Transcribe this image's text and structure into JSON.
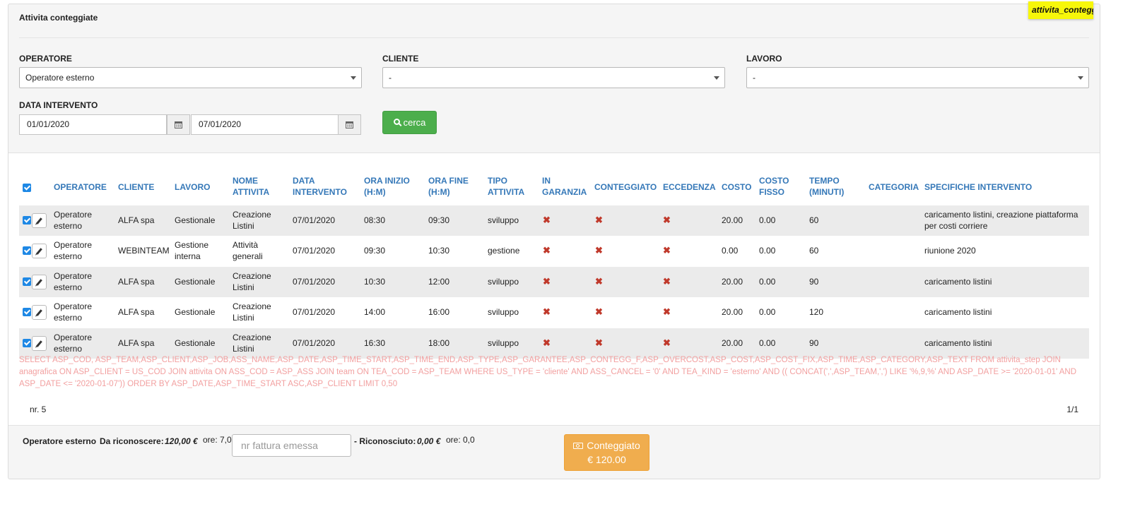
{
  "panel": {
    "title": "Attivita conteggiate",
    "tag": "attivita_conteggi"
  },
  "filters": {
    "operatore": {
      "label": "OPERATORE",
      "value": "Operatore esterno"
    },
    "cliente": {
      "label": "CLIENTE",
      "value": "-"
    },
    "lavoro": {
      "label": "LAVORO",
      "value": "-"
    },
    "data": {
      "label": "DATA INTERVENTO",
      "from": "01/01/2020",
      "to": "07/01/2020"
    },
    "search_label": "cerca"
  },
  "table": {
    "headers": {
      "operatore": "OPERATORE",
      "cliente": "CLIENTE",
      "lavoro": "LAVORO",
      "nome": "NOME\nATTIVITA",
      "data": "DATA\nINTERVENTO",
      "inizio": "ORA INIZIO\n(H:M)",
      "fine": "ORA FINE\n(H:M)",
      "tipo": "TIPO\nATTIVITA",
      "garanzia": "IN\nGARANZIA",
      "conteggiato": "CONTEGGIATO",
      "eccedenza": "ECCEDENZA",
      "costo": "COSTO",
      "costo_fisso": "COSTO\nFISSO",
      "tempo": "TEMPO\n(MINUTI)",
      "categoria": "CATEGORIA",
      "specifiche": "SPECIFICHE INTERVENTO"
    },
    "rows": [
      {
        "operatore": "Operatore\nesterno",
        "cliente": "ALFA spa",
        "lavoro": "Gestionale",
        "nome": "Creazione\nListini",
        "data": "07/01/2020",
        "inizio": "08:30",
        "fine": "09:30",
        "tipo": "sviluppo",
        "garanzia": "✖",
        "conteggiato": "✖",
        "eccedenza": "✖",
        "costo": "20.00",
        "costo_fisso": "0.00",
        "tempo": "60",
        "categoria": "",
        "specifiche": "caricamento listini, creazione piattaforma\nper costi corriere"
      },
      {
        "operatore": "Operatore\nesterno",
        "cliente": "WEBINTEAM",
        "lavoro": "Gestione\ninterna",
        "nome": "Attività\ngenerali",
        "data": "07/01/2020",
        "inizio": "09:30",
        "fine": "10:30",
        "tipo": "gestione",
        "garanzia": "✖",
        "conteggiato": "✖",
        "eccedenza": "✖",
        "costo": "0.00",
        "costo_fisso": "0.00",
        "tempo": "60",
        "categoria": "",
        "specifiche": "riunione 2020"
      },
      {
        "operatore": "Operatore\nesterno",
        "cliente": "ALFA spa",
        "lavoro": "Gestionale",
        "nome": "Creazione\nListini",
        "data": "07/01/2020",
        "inizio": "10:30",
        "fine": "12:00",
        "tipo": "sviluppo",
        "garanzia": "✖",
        "conteggiato": "✖",
        "eccedenza": "✖",
        "costo": "20.00",
        "costo_fisso": "0.00",
        "tempo": "90",
        "categoria": "",
        "specifiche": "caricamento listini"
      },
      {
        "operatore": "Operatore\nesterno",
        "cliente": "ALFA spa",
        "lavoro": "Gestionale",
        "nome": "Creazione\nListini",
        "data": "07/01/2020",
        "inizio": "14:00",
        "fine": "16:00",
        "tipo": "sviluppo",
        "garanzia": "✖",
        "conteggiato": "✖",
        "eccedenza": "✖",
        "costo": "20.00",
        "costo_fisso": "0.00",
        "tempo": "120",
        "categoria": "",
        "specifiche": "caricamento listini"
      },
      {
        "operatore": "Operatore\nesterno",
        "cliente": "ALFA spa",
        "lavoro": "Gestionale",
        "nome": "Creazione\nListini",
        "data": "07/01/2020",
        "inizio": "16:30",
        "fine": "18:00",
        "tipo": "sviluppo",
        "garanzia": "✖",
        "conteggiato": "✖",
        "eccedenza": "✖",
        "costo": "20.00",
        "costo_fisso": "0.00",
        "tempo": "90",
        "categoria": "",
        "specifiche": "caricamento listini"
      }
    ]
  },
  "sql_debug": "SELECT ASP_COD, ASP_TEAM,ASP_CLIENT,ASP_JOB,ASS_NAME,ASP_DATE,ASP_TIME_START,ASP_TIME_END,ASP_TYPE,ASP_GARANTEE,ASP_CONTEGG_F,ASP_OVERCOST,ASP_COST,ASP_COST_FIX,ASP_TIME,ASP_CATEGORY,ASP_TEXT FROM attivita_step JOIN anagrafica ON ASP_CLIENT = US_COD JOIN attivita ON ASS_COD = ASP_ASS JOIN team ON TEA_COD = ASP_TEAM WHERE US_TYPE = 'cliente' AND ASS_CANCEL = '0' AND TEA_KIND = 'esterno' AND (( CONCAT(',',ASP_TEAM,',') LIKE '%,9,%' AND ASP_DATE >= '2020-01-01' AND ASP_DATE <= '2020-01-07')) ORDER BY ASP_DATE,ASP_TIME_START ASC,ASP_CLIENT LIMIT 0,50",
  "count": "nr. 5",
  "pagination": "1/1",
  "footer": {
    "operatore": "Operatore esterno",
    "da_riconoscere_label": "Da riconoscere:",
    "da_riconoscere_value": "120,00 €",
    "ore1": "ore: 7,0",
    "fattura_placeholder": "nr fattura emessa",
    "riconosciuto_label": "- Riconosciuto:",
    "riconosciuto_value": "0,00 €",
    "ore2": "ore: 0,0",
    "button_line1": "Conteggiato",
    "button_line2": "€ 120.00"
  }
}
